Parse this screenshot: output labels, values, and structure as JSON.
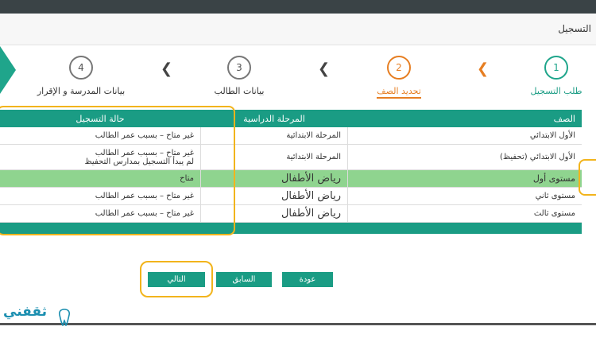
{
  "title": "التسجيل",
  "steps": [
    {
      "num": "1",
      "label": "طلب التسجيل"
    },
    {
      "num": "2",
      "label": "تحديد الصف"
    },
    {
      "num": "3",
      "label": "بيانات الطالب"
    },
    {
      "num": "4",
      "label": "بيانات المدرسة و الإقرار"
    }
  ],
  "table": {
    "headers": [
      "الصف",
      "المرحلة الدراسية",
      "حالة التسجيل"
    ],
    "rows": [
      {
        "grade": "الأول الابتدائي",
        "stage": "المرحلة الابتدائية",
        "status": "غير متاح – بسبب عمر الطالب"
      },
      {
        "grade": "الأول الابتدائي (تحفيظ)",
        "stage": "المرحلة الابتدائية",
        "status": "غير متاح – بسبب عمر الطالب",
        "status2": "لم يبدأ التسجيل بمدارس التحفيظ"
      },
      {
        "grade": "مستوى أول",
        "stage": "رياض الأطفال",
        "status": "متاح"
      },
      {
        "grade": "مستوى ثاني",
        "stage": "رياض الأطفال",
        "status": "غير متاح – بسبب عمر الطالب"
      },
      {
        "grade": "مستوى ثالث",
        "stage": "رياض الأطفال",
        "status": "غير متاح – بسبب عمر الطالب"
      }
    ]
  },
  "buttons": {
    "back": "عودة",
    "previous": "السابق",
    "next": "التالي"
  },
  "watermark": "ثقفني",
  "colors": {
    "primary": "#1a9c84",
    "accent": "#e67e22",
    "highlight_row": "#8fd48f",
    "annotation": "#f2b41c"
  }
}
